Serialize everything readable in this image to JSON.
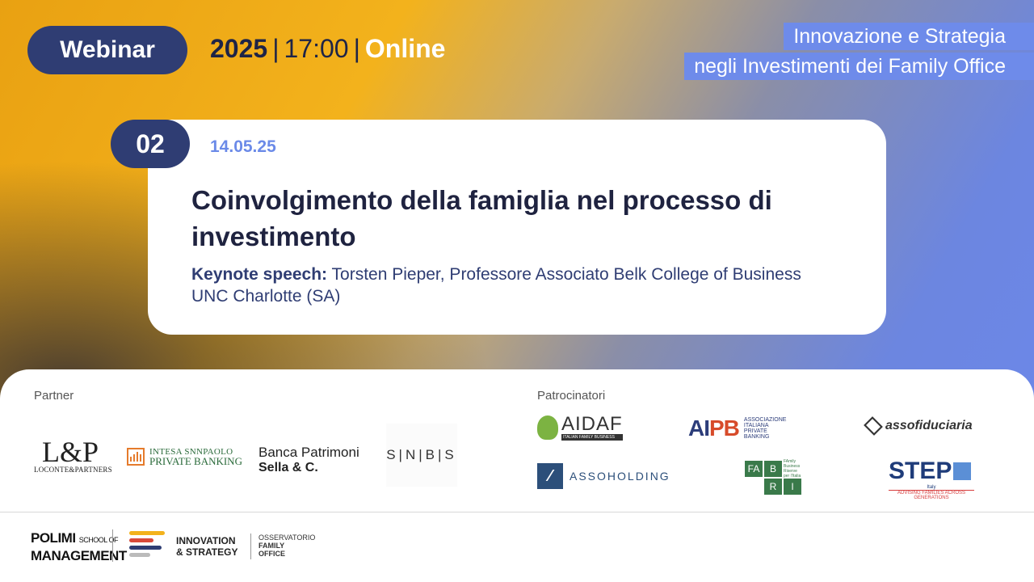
{
  "header": {
    "webinar_label": "Webinar",
    "year": "2025",
    "separator": "|",
    "time": "17:00",
    "mode": "Online",
    "series_title_line1": "Innovazione e Strategia",
    "series_title_line2": "negli Investimenti dei Family Office"
  },
  "session": {
    "number": "02",
    "date": "14.05.25",
    "title": "Coinvolgimento della famiglia nel processo di investimento",
    "keynote_label": "Keynote speech:",
    "keynote_text": " Torsten Pieper, Professore Associato Belk College of Business UNC Charlotte (SA)"
  },
  "partners": {
    "label": "Partner",
    "loconte": {
      "mark": "L&P",
      "name": "LOCONTE&PARTNERS"
    },
    "intesa": {
      "line1": "INTESA SNNPAOLO",
      "line2": "PRIVATE BANKING"
    },
    "sella": {
      "line1": "Banca Patrimoni",
      "line2": "Sella & C."
    },
    "snbs": "S|N|B|S"
  },
  "sponsors": {
    "label": "Patrocinatori",
    "aidaf": {
      "name": "AIDAF",
      "tagline": "ITALIAN FAMILY BUSINESS"
    },
    "aipb": {
      "mark_a": "AI",
      "mark_b": "PB",
      "sub1": "ASSOCIAZIONE",
      "sub2": "ITALIANA",
      "sub3": "PRIVATE",
      "sub4": "BANKING"
    },
    "assofiduciaria": "assofiduciaria",
    "assoholding": "ASSOHOLDING",
    "fabri": {
      "f": "FA",
      "b": "B",
      "r": "R",
      "i": "I",
      "note": "FAmily Business Riserve per l'Italia"
    },
    "step": {
      "name": "STEP",
      "country": "Italy",
      "tagline": "ADVISING FAMILIES ACROSS GENERATIONS"
    }
  },
  "footer": {
    "polimi_line1": "POLIMI",
    "polimi_small": "SCHOOL OF",
    "polimi_line2": "MANAGEMENT",
    "is_line1": "INNOVATION",
    "is_line2": "& STRATEGY",
    "ofo_line1": "OSSERVATORIO",
    "ofo_line2": "FAMILY",
    "ofo_line3": "OFFICE"
  },
  "colors": {
    "navy": "#2f3d73",
    "accent_blue": "#6e8bea",
    "gold": "#f3b21c"
  }
}
